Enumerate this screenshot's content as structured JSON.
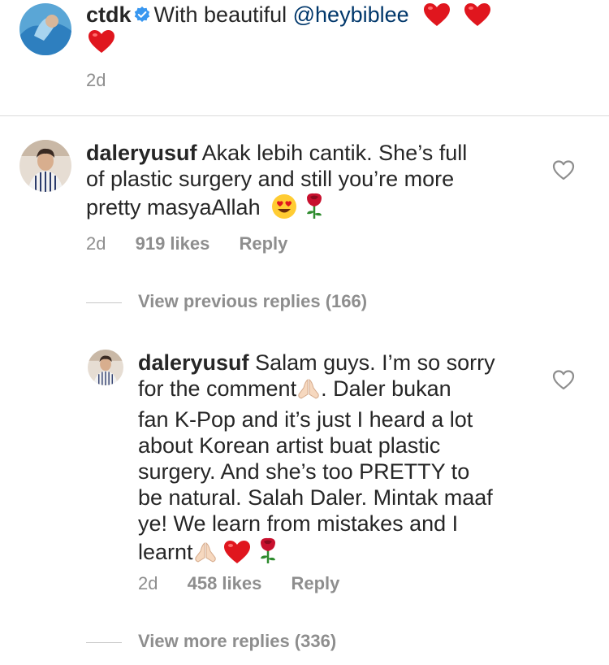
{
  "caption": {
    "username": "ctdk",
    "text_prefix": "With beautiful ",
    "mention": "@heybiblee",
    "time": "2d"
  },
  "comment": {
    "username": "daleryusuf",
    "text_line1": "Akak lebih cantik. She’s full",
    "text_line2": "of plastic surgery and still you’re more",
    "text_line3": "pretty masyaAllah",
    "time": "2d",
    "likes": "919 likes",
    "reply_label": "Reply"
  },
  "view_previous": "View previous replies (166)",
  "reply": {
    "username": "daleryusuf",
    "line1": "Salam guys. I’m so sorry",
    "line2a": "for the comment",
    "line2b": ". Daler bukan",
    "line3": "fan K-Pop and it’s just I heard a lot",
    "line4": "about Korean artist buat plastic",
    "line5": "surgery. And she’s too PRETTY to",
    "line6": "be natural. Salah Daler. Mintak maaf",
    "line7": "ye! We learn from mistakes and I",
    "line8": "learnt",
    "time": "2d",
    "likes": "458 likes",
    "reply_label": "Reply"
  },
  "view_more": "View more replies (336)",
  "colors": {
    "heart_red": "#e0161e",
    "mention_blue": "#00376b",
    "meta_grey": "#8e8e8e",
    "verified_blue": "#3897f0"
  }
}
